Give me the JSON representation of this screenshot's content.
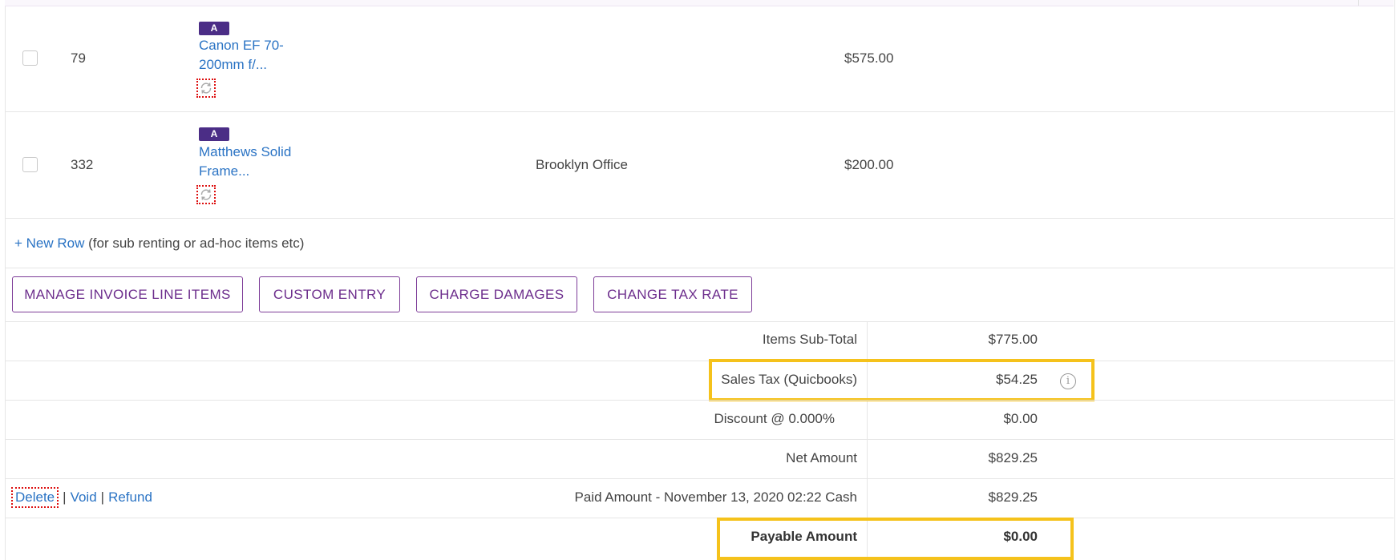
{
  "rows": [
    {
      "qty": "79",
      "badge": "A",
      "item_name": "Canon EF 70-200mm f/...",
      "location": "",
      "price": "$575.00"
    },
    {
      "qty": "332",
      "badge": "A",
      "item_name": "Matthews Solid Frame...",
      "location": "Brooklyn Office",
      "price": "$200.00"
    }
  ],
  "new_row": {
    "link": "+ New Row",
    "hint": "(for sub renting or ad-hoc items etc)"
  },
  "buttons": {
    "manage": "MANAGE INVOICE LINE ITEMS",
    "custom": "CUSTOM ENTRY",
    "damages": "CHARGE DAMAGES",
    "tax_rate": "CHANGE TAX RATE"
  },
  "summary": {
    "subtotal_label": "Items Sub-Total",
    "subtotal_value": "$775.00",
    "tax_label": "Sales Tax (Quicbooks)",
    "tax_value": "$54.25",
    "discount_label": "Discount @ 0.000%",
    "discount_value": "$0.00",
    "net_label": "Net Amount",
    "net_value": "$829.25",
    "paid_label": "Paid Amount - November 13, 2020 02:22 Cash",
    "paid_value": "$829.25",
    "payable_label": "Payable Amount",
    "payable_value": "$0.00"
  },
  "actions": {
    "delete": "Delete",
    "void": "Void",
    "refund": "Refund",
    "separator": "|"
  },
  "icons": {
    "refresh": "refresh-icon",
    "info": "info-icon"
  },
  "colors": {
    "link": "#2a73c4",
    "button_border": "#7d3c98",
    "badge": "#4b2d86",
    "highlight": "#f5c21b",
    "dotted_focus": "#dd1111"
  }
}
